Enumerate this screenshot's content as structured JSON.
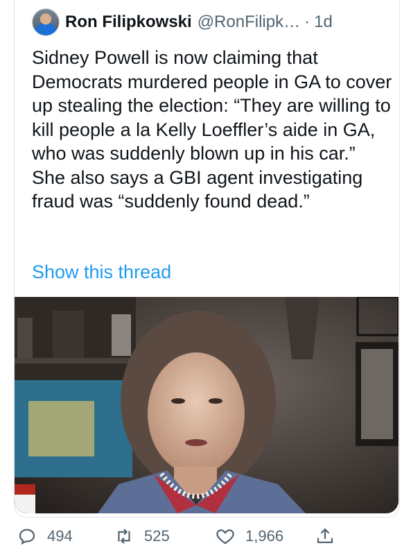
{
  "tweet": {
    "author_name": "Ron Filipkowski",
    "handle": "@RonFilipk…",
    "separator": "·",
    "time": "1d",
    "text": "Sidney Powell is now claiming that Democrats murdered people in GA to cover up stealing the election: “They are willing to kill people a la Kelly Loeffler’s aide in GA, who was suddenly blown up in his car.” She also says a GBI agent investigating fraud was “suddenly found dead.”",
    "show_thread": "Show this thread"
  },
  "actions": {
    "replies": "494",
    "retweets": "525",
    "likes": "1,966"
  },
  "icons": [
    "reply-icon",
    "retweet-icon",
    "like-icon",
    "share-icon"
  ],
  "colors": {
    "link": "#1d9bf0",
    "muted": "#536471",
    "text": "#0f1419"
  }
}
